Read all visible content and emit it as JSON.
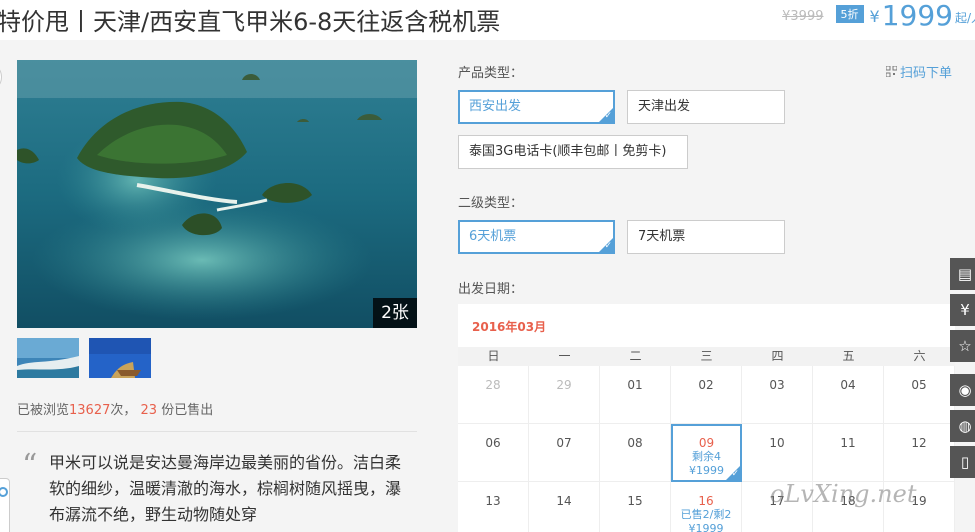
{
  "header": {
    "title": "特价甩丨天津/西安直飞甲米6-8天往返含税机票",
    "original_price": "¥3999",
    "discount": "5折",
    "currency": "¥",
    "price": "1999",
    "unit": "起/人"
  },
  "gallery": {
    "photo_count": "2张",
    "stats_prefix": "已被浏览",
    "views": "13627",
    "stats_mid": "次，",
    "sold": "23",
    "stats_suffix": "份已售出"
  },
  "description": "甲米可以说是安达曼海岸边最美丽的省份。洁白柔软的细纱，温暖清澈的海水，棕榈树随风摇曳，瀑布潺流不绝，野生动物随处穿",
  "product": {
    "type_label": "产品类型：",
    "scan_label": "扫码下单",
    "options": [
      "西安出发",
      "天津出发",
      "泰国3G电话卡(顺丰包邮丨免剪卡)"
    ],
    "sub_label": "二级类型：",
    "sub_options": [
      "6天机票",
      "7天机票"
    ],
    "date_label": "出发日期："
  },
  "calendar": {
    "month": "2016年03月",
    "weekdays": [
      "日",
      "一",
      "二",
      "三",
      "四",
      "五",
      "六"
    ],
    "row1": [
      "28",
      "29",
      "01",
      "02",
      "03",
      "04",
      "05"
    ],
    "row2": [
      "06",
      "07",
      "08",
      "09",
      "10",
      "11",
      "12"
    ],
    "row3": [
      "13",
      "14",
      "15",
      "16",
      "17",
      "18",
      "19"
    ],
    "sel_remain": "剩余4",
    "sel_price": "¥1999",
    "d16_sold": "已售2/剩2",
    "d16_price": "¥1999"
  },
  "side_icons": [
    "clipboard-icon",
    "yen-icon",
    "star-icon",
    "weibo-icon",
    "wechat-icon",
    "phone-icon"
  ],
  "watermark": "oLvXing.net",
  "colors": {
    "accent": "#55a0d8",
    "highlight": "#e8604c"
  }
}
